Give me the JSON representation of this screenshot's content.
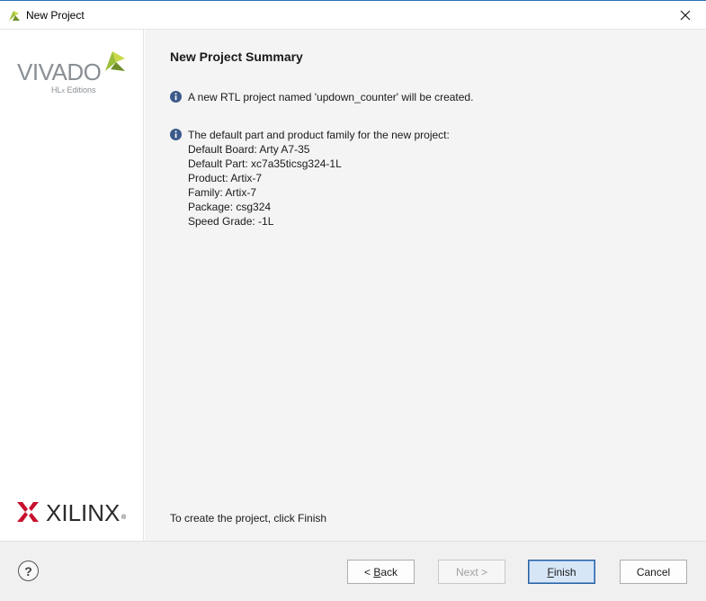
{
  "window": {
    "title": "New Project",
    "close_label": "Close"
  },
  "sidebar": {
    "vivado_brand": "VIVADO",
    "vivado_edition_prefix": "HL",
    "vivado_edition_x": "x",
    "vivado_edition_suffix": " Editions",
    "xilinx_brand": "XILINX",
    "xilinx_reg": "®"
  },
  "main": {
    "title": "New Project Summary",
    "info_1": "A new RTL project named 'updown_counter' will be created.",
    "info_2": "The default part and product family for the new project:",
    "details": [
      "Default Board: Arty A7-35",
      "Default Part: xc7a35ticsg324-1L",
      "Product: Artix-7",
      "Family: Artix-7",
      "Package: csg324",
      "Speed Grade: -1L"
    ],
    "footer_note": "To create the project, click Finish"
  },
  "buttons": {
    "help": "?",
    "back_prefix": "< ",
    "back_mnemonic": "B",
    "back_rest": "ack",
    "next": "Next >",
    "finish_mnemonic": "F",
    "finish_rest": "inish",
    "cancel": "Cancel"
  },
  "colors": {
    "accent": "#2a5f9e",
    "info_icon": "#3b5a8a",
    "xilinx_red": "#c8102e",
    "vivado_green": "#9bbf3a"
  }
}
